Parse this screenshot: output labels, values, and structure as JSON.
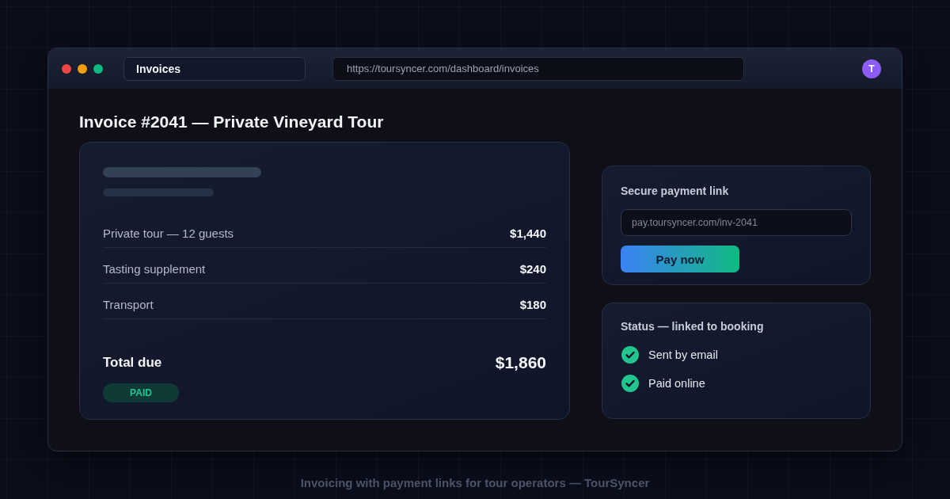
{
  "browser": {
    "tab": {
      "label": "Invoices"
    },
    "address_bar": {
      "value": "https://toursyncer.com/dashboard/invoices"
    },
    "avatar": {
      "initial": "T"
    }
  },
  "invoice": {
    "title": "Invoice #2041 — Private Vineyard Tour",
    "line_items": [
      {
        "label": "Private tour — 12 guests",
        "amount": "$1,440"
      },
      {
        "label": "Tasting supplement",
        "amount": "$240"
      },
      {
        "label": "Transport",
        "amount": "$180"
      }
    ],
    "total": {
      "label": "Total due",
      "amount": "$1,860"
    },
    "status_badge": "PAID"
  },
  "payment_link": {
    "title": "Secure payment link",
    "link_field": {
      "value": "pay.toursyncer.com/inv-2041"
    },
    "button": "Pay now"
  },
  "status": {
    "title": "Status — linked to booking",
    "items": [
      {
        "label": "Sent by email",
        "checked": true
      },
      {
        "label": "Paid online",
        "checked": true
      }
    ]
  },
  "caption": "Invoicing with payment links for tour operators — TourSyncer"
}
